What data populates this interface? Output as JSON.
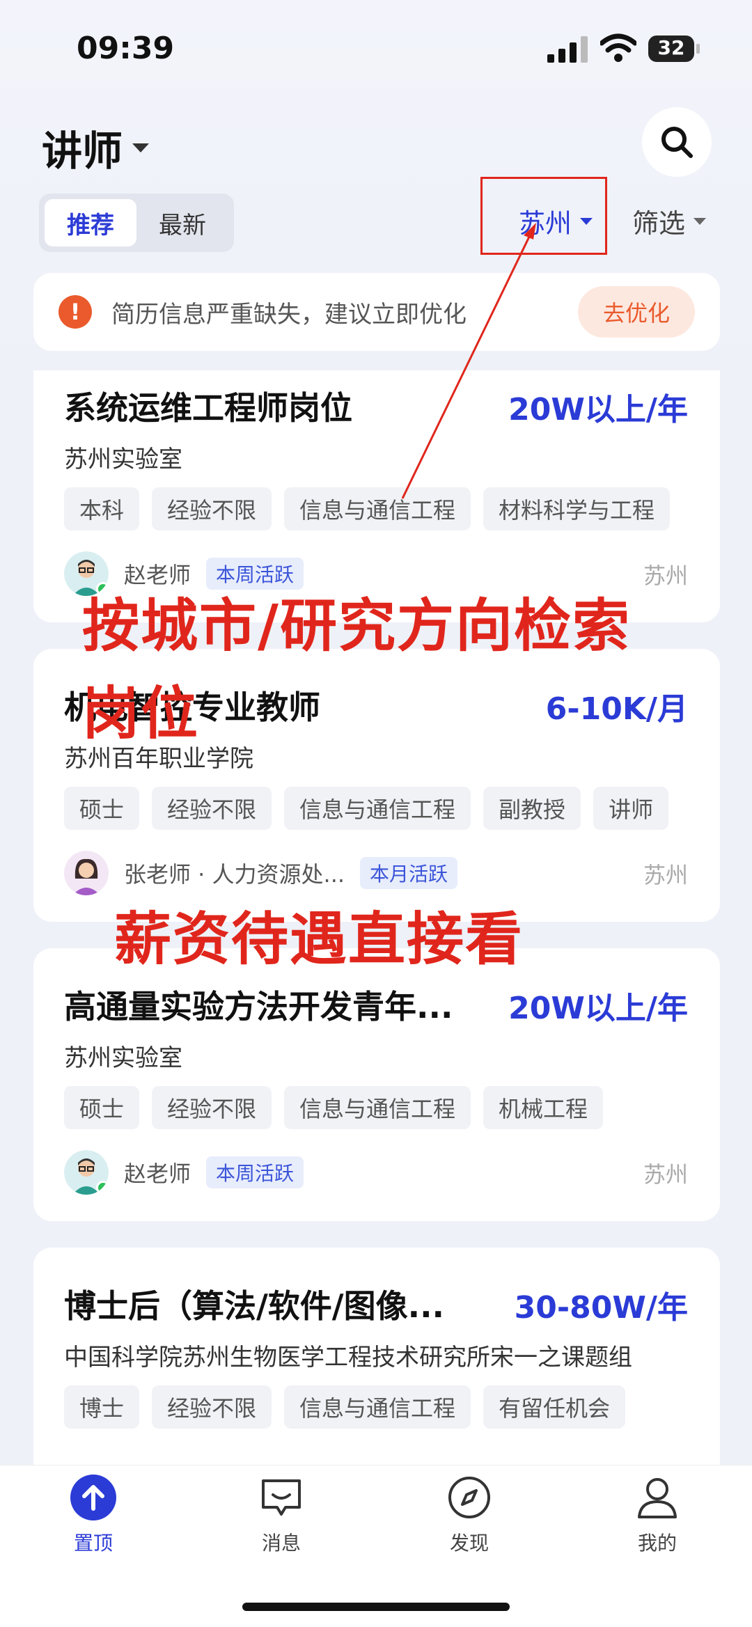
{
  "status_bar": {
    "time": "09:39",
    "battery": "32"
  },
  "header": {
    "title": "讲师"
  },
  "segments": [
    {
      "label": "推荐",
      "active": true
    },
    {
      "label": "最新",
      "active": false
    }
  ],
  "filters": {
    "city": "苏州",
    "filter_label": "筛选"
  },
  "alert": {
    "text": "简历信息严重缺失，建议立即优化",
    "button": "去优化"
  },
  "jobs": [
    {
      "title": "系统运维工程师岗位",
      "salary": "20W以上/年",
      "org": "苏州实验室",
      "tags": [
        "本科",
        "经验不限",
        "信息与通信工程",
        "材料科学与工程"
      ],
      "recruiter": "赵老师",
      "badge": "本周活跃",
      "location": "苏州"
    },
    {
      "title": "机电智控专业教师",
      "salary": "6-10K/月",
      "org": "苏州百年职业学院",
      "tags": [
        "硕士",
        "经验不限",
        "信息与通信工程",
        "副教授",
        "讲师"
      ],
      "recruiter": "张老师 · 人力资源处...",
      "badge": "本月活跃",
      "location": "苏州"
    },
    {
      "title": "高通量实验方法开发青年...",
      "salary": "20W以上/年",
      "org": "苏州实验室",
      "tags": [
        "硕士",
        "经验不限",
        "信息与通信工程",
        "机械工程"
      ],
      "recruiter": "赵老师",
      "badge": "本周活跃",
      "location": "苏州"
    },
    {
      "title": "博士后（算法/软件/图像...",
      "salary": "30-80W/年",
      "org": "中国科学院苏州生物医学工程技术研究所宋一之课题组",
      "tags": [
        "博士",
        "经验不限",
        "信息与通信工程",
        "有留任机会"
      ],
      "recruiter": "",
      "badge": "",
      "location": ""
    }
  ],
  "annotations": {
    "line1": "按城市/研究方向检索",
    "line2": "岗位",
    "line3": "薪资待遇直接看"
  },
  "tabbar": [
    {
      "label": "置顶",
      "icon": "arrow-up-icon",
      "active": true
    },
    {
      "label": "消息",
      "icon": "message-icon",
      "active": false
    },
    {
      "label": "发现",
      "icon": "compass-icon",
      "active": false
    },
    {
      "label": "我的",
      "icon": "person-icon",
      "active": false
    }
  ],
  "colors": {
    "accent": "#2b3bd6",
    "annotation": "#e0261c",
    "warning": "#ea5a2c"
  }
}
